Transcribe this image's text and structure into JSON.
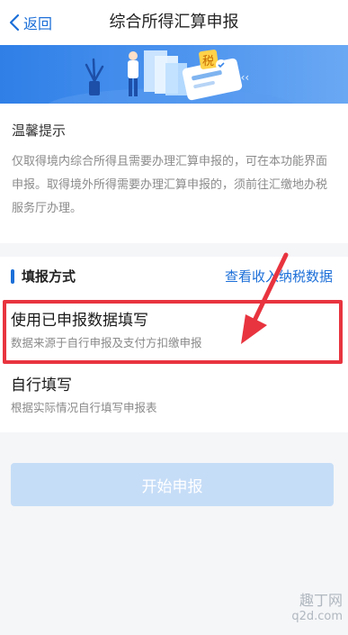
{
  "nav": {
    "back_label": "返回",
    "title": "综合所得汇算申报"
  },
  "banner": {
    "badge_text": "税"
  },
  "notice": {
    "title": "温馨提示",
    "body": "仅取得境内综合所得且需要办理汇算申报的，可在本功能界面申报。取得境外所得需要办理汇算申报的，须前往汇缴地办税服务厅办理。"
  },
  "method": {
    "title": "填报方式",
    "link": "查看收入纳税数据",
    "options": [
      {
        "title": "使用已申报数据填写",
        "desc": "数据来源于自行申报及支付方扣缴申报"
      },
      {
        "title": "自行填写",
        "desc": "根据实际情况自行填写申报表"
      }
    ]
  },
  "actions": {
    "start_label": "开始申报"
  },
  "watermark": {
    "top": "趣丁网",
    "bottom": "q2d.com"
  },
  "colors": {
    "accent": "#1c6fd8",
    "highlight": "#e8343f",
    "button_disabled": "#c6ddf7",
    "banner": "#3a86ea"
  }
}
